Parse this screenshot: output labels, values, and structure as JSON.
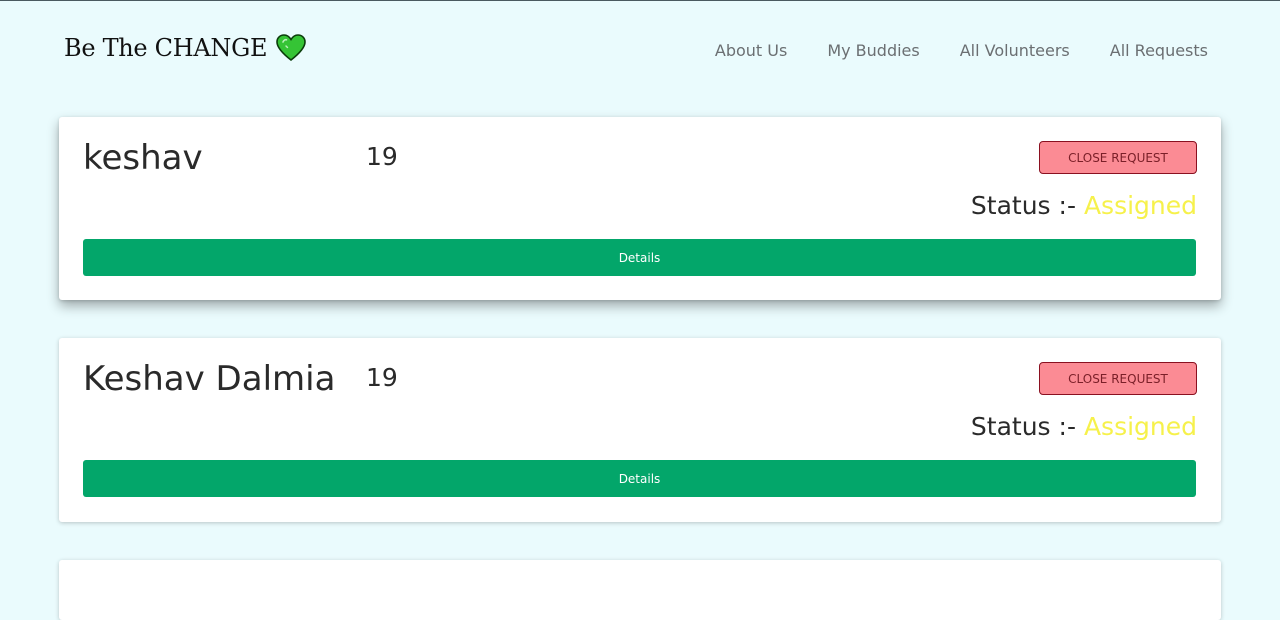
{
  "brand": {
    "title": "Be The CHANGE",
    "icon": "green-heart-icon",
    "icon_color": "#35c435"
  },
  "nav": {
    "links": [
      "About Us",
      "My Buddies",
      "All Volunteers",
      "All Requests"
    ]
  },
  "requests": [
    {
      "name": "keshav",
      "age": "19",
      "close_label": "CLOSE REQUEST",
      "status_label": "Status :-",
      "status_value": "Assigned",
      "details_label": "Details"
    },
    {
      "name": "Keshav Dalmia",
      "age": "19",
      "close_label": "CLOSE REQUEST",
      "status_label": "Status :-",
      "status_value": "Assigned",
      "details_label": "Details"
    }
  ],
  "colors": {
    "page_background": "#eafbfd",
    "details_button": "#03a66a",
    "close_button": "#fb8b94",
    "status_assigned": "#f6f14b"
  }
}
